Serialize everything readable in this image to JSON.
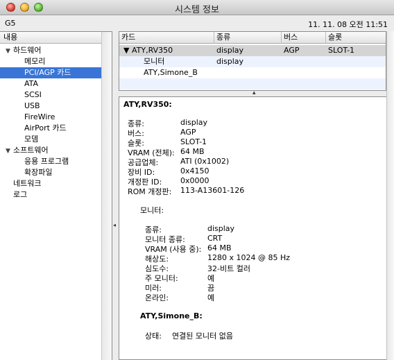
{
  "window": {
    "title": "시스템 정보"
  },
  "infobar": {
    "machine": "G5",
    "datetime": "11. 11. 08 오전 11:51"
  },
  "sidebar": {
    "header": "내용",
    "items": [
      {
        "label": "하드웨어",
        "expanded": true
      },
      {
        "label": "메모리"
      },
      {
        "label": "PCI/AGP 카드",
        "selected": true
      },
      {
        "label": "ATA"
      },
      {
        "label": "SCSI"
      },
      {
        "label": "USB"
      },
      {
        "label": "FireWire"
      },
      {
        "label": "AirPort 카드"
      },
      {
        "label": "모뎀"
      },
      {
        "label": "소프트웨어",
        "expanded": true
      },
      {
        "label": "응용 프로그램"
      },
      {
        "label": "확장파일"
      },
      {
        "label": "네트워크"
      },
      {
        "label": "로그"
      }
    ]
  },
  "table": {
    "columns": [
      "카드",
      "종류",
      "버스",
      "슬롯"
    ],
    "rows": [
      {
        "card": "ATY,RV350",
        "type": "display",
        "bus": "AGP",
        "slot": "SLOT-1"
      },
      {
        "card": "모니터",
        "type": "display",
        "bus": "",
        "slot": ""
      },
      {
        "card": "ATY,Simone_B",
        "type": "",
        "bus": "",
        "slot": ""
      }
    ]
  },
  "detail": {
    "card_title": "ATY,RV350:",
    "card_props": [
      {
        "label": "종류:",
        "value": "display"
      },
      {
        "label": "버스:",
        "value": "AGP"
      },
      {
        "label": "슬롯:",
        "value": "SLOT-1"
      },
      {
        "label": "VRAM (전체):",
        "value": "64 MB"
      },
      {
        "label": "공급업체:",
        "value": "ATI (0x1002)"
      },
      {
        "label": "장비 ID:",
        "value": "0x4150"
      },
      {
        "label": "개정판 ID:",
        "value": "0x0000"
      },
      {
        "label": "ROM 개정판:",
        "value": "113-A13601-126"
      }
    ],
    "monitor_title": "모니터:",
    "monitor_props": [
      {
        "label": "종류:",
        "value": "display"
      },
      {
        "label": "모니터 종류:",
        "value": "CRT"
      },
      {
        "label": "VRAM (사용 중):",
        "value": "64 MB"
      },
      {
        "label": "해상도:",
        "value": "1280 x 1024 @ 85 Hz"
      },
      {
        "label": "심도수:",
        "value": "32-비트 컬러"
      },
      {
        "label": "주 모니터:",
        "value": "예"
      },
      {
        "label": "미러:",
        "value": "끔"
      },
      {
        "label": "온라인:",
        "value": "예"
      }
    ],
    "second_title": "ATY,Simone_B:",
    "second_status_label": "상태:",
    "second_status_value": "연결된 모니터 없음"
  }
}
